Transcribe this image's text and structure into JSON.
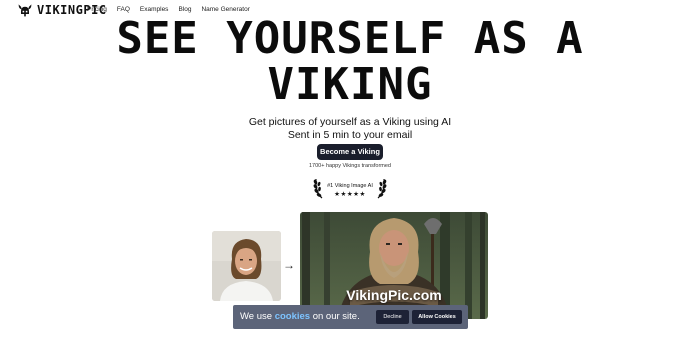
{
  "nav": {
    "logo_text": "VIKINGPIC",
    "logo_icon": "viking-helmet-icon",
    "links": [
      "Pricing",
      "FAQ",
      "Examples",
      "Blog",
      "Name Generator"
    ]
  },
  "hero": {
    "title_line1": "SEE YOURSELF AS A",
    "title_line2": "VIKING",
    "subtitle_line1": "Get pictures of yourself as a Viking using AI",
    "subtitle_line2": "Sent in 5 min to your email",
    "cta_label": "Become a Viking",
    "happy_text": "1700+ happy Vikings transformed",
    "badge_text": "#1 Viking Image AI",
    "badge_stars": "★★★★★",
    "rating_stars": 5
  },
  "images": {
    "arrow": "→",
    "watermark": "VikingPic.com"
  },
  "cookie": {
    "text_before": "We use ",
    "link": "cookies",
    "text_after": " on our site.",
    "decline_label": "Decline",
    "allow_label": "Allow Cookies"
  },
  "colors": {
    "cta_bg": "#1a1e2c",
    "cookie_bg": "#5c6479",
    "cookie_link": "#7dc3ff",
    "cookie_button_bg": "#1d2236"
  }
}
